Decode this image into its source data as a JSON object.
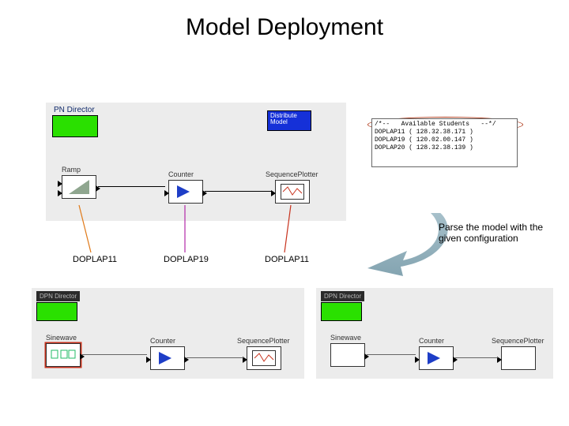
{
  "title": "Model Deployment",
  "top_model": {
    "director_label": "PN Director",
    "distribute_label": "Distribute\nModel",
    "actors": {
      "ramp": "Ramp",
      "counter": "Counter",
      "plotter": "SequencePlotter"
    }
  },
  "hosts": {
    "a": "DOPLAP11",
    "b": "DOPLAP19",
    "c": "DOPLAP11"
  },
  "config": {
    "header": "/*--   Available Students   --*/",
    "lines": [
      "DOPLAP11 ( 128.32.38.171 )",
      "DOPLAP19 ( 120.02.00.147 )",
      "DOPLAP20 ( 128.32.38.139 )"
    ]
  },
  "caption": "Parse the model with the given configuration",
  "bottom": {
    "director_label": "DPN Director",
    "actors": {
      "sine": "Sinewave",
      "counter": "Counter",
      "plotter": "SequencePlotter"
    }
  }
}
